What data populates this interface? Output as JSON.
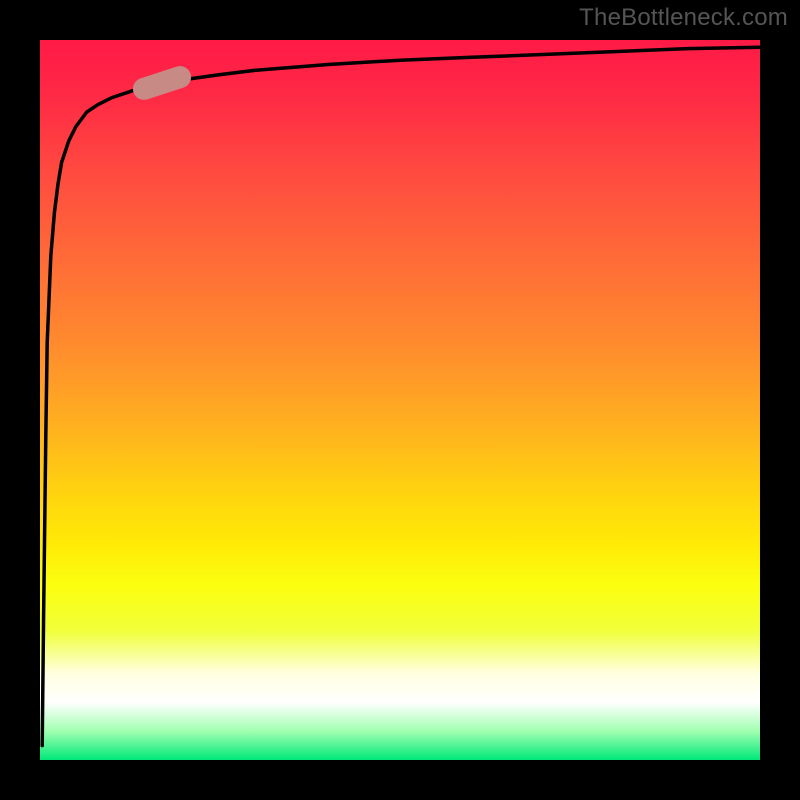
{
  "watermark": "TheBottleneck.com",
  "colors": {
    "frame": "#000000",
    "gradient_top": "#ff1a46",
    "gradient_mid": "#ffea06",
    "gradient_bottom": "#00e878",
    "curve": "#000000",
    "marker": "#c78a85"
  },
  "chart_data": {
    "type": "line",
    "title": "",
    "xlabel": "",
    "ylabel": "",
    "xlim": [
      0,
      100
    ],
    "ylim": [
      0,
      100
    ],
    "grid": false,
    "legend": false,
    "notes": "Axes unlabeled; values estimated from pixel positions within plot area. Inner gradient fill spans red→orange→yellow→white→green top to bottom. Curve rises steeply from near origin then asymptotically approaches y≈100 as x increases. A small rounded marker sits on the curve around x≈17.",
    "series": [
      {
        "name": "curve",
        "x": [
          0.3,
          0.5,
          0.8,
          1.0,
          1.5,
          2.0,
          2.5,
          3.0,
          4.0,
          5.0,
          6.5,
          8.0,
          10,
          13,
          16,
          20,
          25,
          30,
          40,
          50,
          60,
          75,
          90,
          100
        ],
        "y": [
          2,
          20,
          45,
          58,
          70,
          76,
          80,
          83,
          86,
          88,
          90,
          91,
          92,
          93,
          93.8,
          94.5,
          95.2,
          95.8,
          96.6,
          97.2,
          97.6,
          98.2,
          98.8,
          99
        ]
      }
    ],
    "marker": {
      "x": 17,
      "y": 94,
      "angle_deg": -18
    }
  }
}
